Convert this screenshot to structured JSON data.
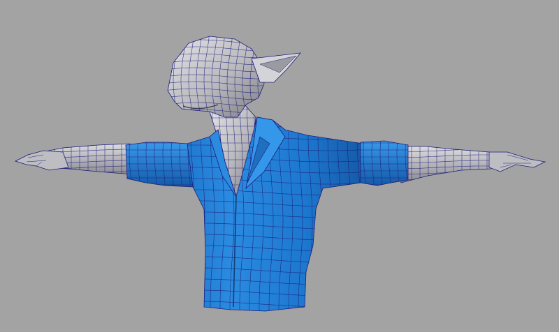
{
  "viewport": {
    "background": "#a3a3a3",
    "wireframe_color": "#1c1c7a",
    "shirt_color": "#1f7fd4",
    "shirt_shadow": "#1862b0",
    "shirt_highlight": "#3a9ae8",
    "skin_color": "#c4c4c6",
    "skin_shadow": "#8e8e94",
    "skin_highlight": "#e2e2e6"
  },
  "model": {
    "icon": "character-mesh-icon",
    "parts": [
      "head",
      "neck",
      "left-arm",
      "right-arm",
      "left-hand",
      "right-hand",
      "shirt-torso",
      "left-sleeve",
      "right-sleeve",
      "collar"
    ]
  }
}
